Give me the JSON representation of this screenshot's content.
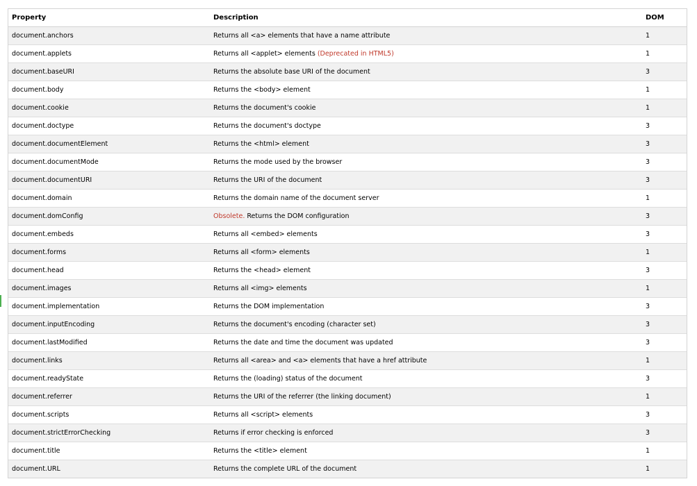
{
  "table": {
    "headers": {
      "property": "Property",
      "description": "Description",
      "dom": "DOM"
    },
    "rows": [
      {
        "property": "document.anchors",
        "description": "Returns all <a> elements that have a name attribute",
        "dom": "1"
      },
      {
        "property": "document.applets",
        "description": "Returns all <applet> elements",
        "note": "(Deprecated in HTML5)",
        "dom": "1"
      },
      {
        "property": "document.baseURI",
        "description": "Returns the absolute base URI of the document",
        "dom": "3"
      },
      {
        "property": "document.body",
        "description": "Returns the <body> element",
        "dom": "1"
      },
      {
        "property": "document.cookie",
        "description": "Returns the document's cookie",
        "dom": "1"
      },
      {
        "property": "document.doctype",
        "description": "Returns the document's doctype",
        "dom": "3"
      },
      {
        "property": "document.documentElement",
        "description": "Returns the <html> element",
        "dom": "3"
      },
      {
        "property": "document.documentMode",
        "description": "Returns the mode used by the browser",
        "dom": "3"
      },
      {
        "property": "document.documentURI",
        "description": "Returns the URI of the document",
        "dom": "3"
      },
      {
        "property": "document.domain",
        "description": "Returns the domain name of the document server",
        "dom": "1"
      },
      {
        "property": "document.domConfig",
        "prefix": "Obsolete.",
        "description": "Returns the DOM configuration",
        "dom": "3"
      },
      {
        "property": "document.embeds",
        "description": "Returns all <embed> elements",
        "dom": "3"
      },
      {
        "property": "document.forms",
        "description": "Returns all <form> elements",
        "dom": "1"
      },
      {
        "property": "document.head",
        "description": "Returns the <head> element",
        "dom": "3"
      },
      {
        "property": "document.images",
        "description": "Returns all <img> elements",
        "dom": "1"
      },
      {
        "property": "document.implementation",
        "description": "Returns the DOM implementation",
        "dom": "3"
      },
      {
        "property": "document.inputEncoding",
        "description": "Returns the document's encoding (character set)",
        "dom": "3"
      },
      {
        "property": "document.lastModified",
        "description": "Returns the date and time the document was updated",
        "dom": "3"
      },
      {
        "property": "document.links",
        "description": "Returns all <area> and <a> elements that have a href attribute",
        "dom": "1"
      },
      {
        "property": "document.readyState",
        "description": "Returns the (loading) status of the document",
        "dom": "3"
      },
      {
        "property": "document.referrer",
        "description": "Returns the URI of the referrer (the linking document)",
        "dom": "1"
      },
      {
        "property": "document.scripts",
        "description": "Returns all <script> elements",
        "dom": "3"
      },
      {
        "property": "document.strictErrorChecking",
        "description": "Returns if error checking is enforced",
        "dom": "3"
      },
      {
        "property": "document.title",
        "description": "Returns the <title> element",
        "dom": "1"
      },
      {
        "property": "document.URL",
        "description": "Returns the complete URL of the document",
        "dom": "1"
      }
    ],
    "colors": {
      "note": "#c0392b",
      "stripe": "#f1f1f1",
      "border": "#d4d4d4",
      "marker": "#4caf50"
    }
  }
}
